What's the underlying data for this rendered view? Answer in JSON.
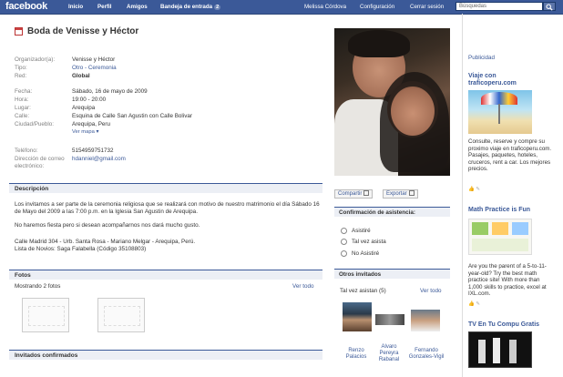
{
  "topbar": {
    "logo": "facebook",
    "nav": [
      "Inicio",
      "Perfil",
      "Amigos",
      "Bandeja de entrada"
    ],
    "inbox_count": "2",
    "user_name": "Melissa Córdova",
    "settings": "Configuración",
    "logout": "Cerrar sesión",
    "search_placeholder": "Búsquedas"
  },
  "event": {
    "title": "Boda de Venisse y Héctor",
    "fields": [
      {
        "label": "Organizador(a):",
        "value": "Venisse y Héctor"
      },
      {
        "label": "Tipo:",
        "value": "Otro - Ceremonia"
      },
      {
        "label": "Red:",
        "value": "Global"
      },
      {
        "label": "Fecha:",
        "value": "Sábado, 16 de mayo de 2009"
      },
      {
        "label": "Hora:",
        "value": "19:00 - 20:00"
      },
      {
        "label": "Lugar:",
        "value": "Arequipa"
      },
      {
        "label": "Calle:",
        "value": "Esquina de Calle San Agustin con Calle Bolivar"
      },
      {
        "label": "Ciudad/Pueblo:",
        "value": "Arequipa, Peru"
      }
    ],
    "map_link": "Ver mapa",
    "phone_label": "Teléfono:",
    "phone": "5154959751732",
    "email_label": "Dirección de correo electrónico:",
    "email": "hdanniel@gmail.com"
  },
  "description": {
    "heading": "Descripción",
    "p1": "Los invitamos a ser parte de la ceremonia religiosa que se realizará con motivo de nuestro matrimonio el día Sábado 16 de Mayo del 2009 a las 7:00 p.m. en la Iglesia San Agustin de Arequipa.",
    "p2": "No haremos fiesta pero si desean acompañarnos nos dará mucho gusto.",
    "p3": "Calle Madrid 304 - Urb. Santa Rosa - Mariano Melgar - Arequipa, Perú.",
    "p4": "Lista de Novios: Saga Falabella (Código 35108803)"
  },
  "photos": {
    "heading": "Fotos",
    "showing": "Mostrando 2 fotos",
    "see_all": "Ver todo"
  },
  "confirmed": {
    "heading": "Invitados confirmados"
  },
  "actions": {
    "share": "Compartir",
    "export": "Exportar"
  },
  "rsvp": {
    "heading": "Confirmación de asistencia:",
    "options": [
      "Asistiré",
      "Tal vez asista",
      "No Asistiré"
    ]
  },
  "others": {
    "heading": "Otros invitados",
    "maybe": "Tal vez asistan (5)",
    "see_all": "Ver todo",
    "friends": [
      {
        "line1": "Renzo",
        "line2": "Palacios",
        "line3": ""
      },
      {
        "line1": "Alvaro",
        "line2": "Pereyra",
        "line3": "Rabanal"
      },
      {
        "line1": "Fernando",
        "line2": "Gonzales-Vigil",
        "line3": ""
      }
    ]
  },
  "ads": {
    "heading": "Publicidad",
    "ad1": {
      "title1": "Viaje con",
      "title2": "traficoperu.com",
      "body": "Consulte, reserve y compre su proximo viaje en traficoperu.com. Pasajes, paquetes, hoteles, cruceros, rent a car. Los mejores precios."
    },
    "ad2": {
      "title": "Math Practice is Fun",
      "body": "Are you the parent of a 5-to-11-year-old? Try the best math practice site! With more than 1,000 skills to practice, excel at IXL.com."
    },
    "ad3": {
      "title": "TV En Tu Compu Gratis"
    }
  }
}
